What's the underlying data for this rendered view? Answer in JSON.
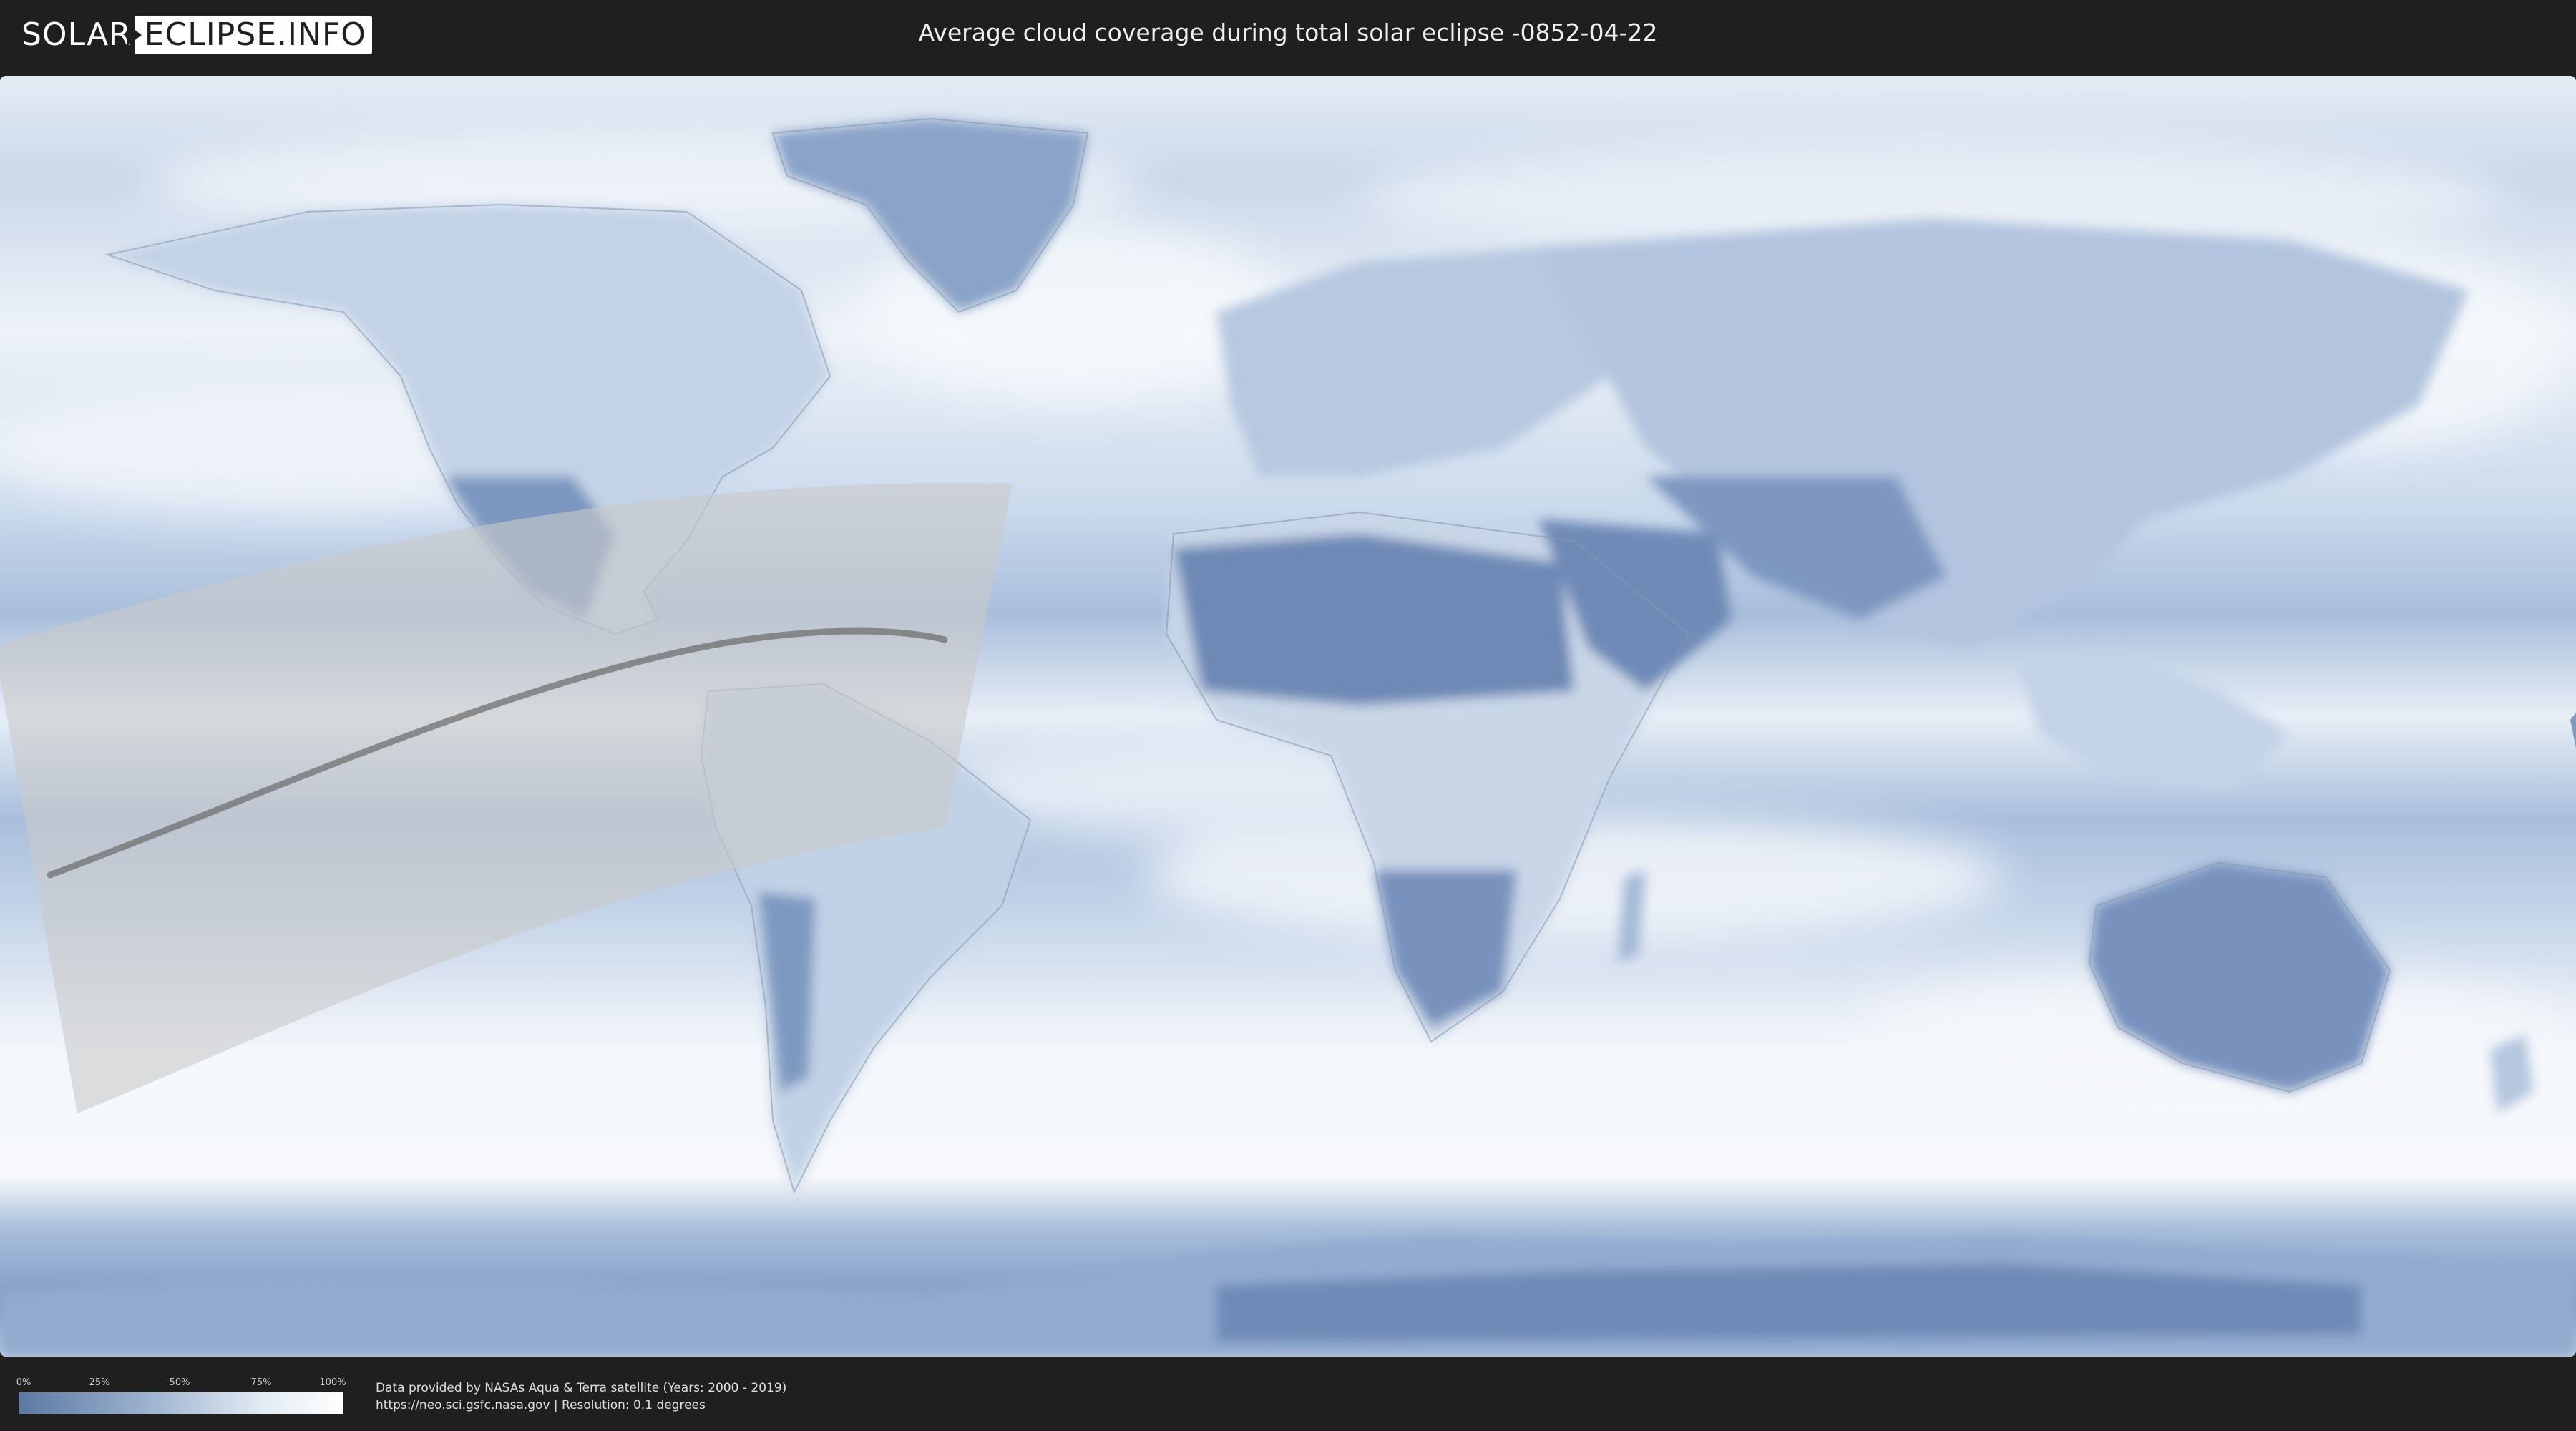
{
  "header": {
    "logo_left": "SOLAR",
    "logo_right": "ECLIPSE.INFO",
    "title": "Average cloud coverage during total solar eclipse -0852-04-22"
  },
  "map": {
    "colors": {
      "ocean_clear": "#7f9bc3",
      "cloud": "#f2f6fb",
      "land_clear": "#6b86b3",
      "eclipse_band": "#c9c9c9",
      "central_line": "#6a6a6a",
      "borders": "#8797ad"
    }
  },
  "legend": {
    "ticks": [
      "0%",
      "25%",
      "50%",
      "75%",
      "100%"
    ],
    "values": [
      0,
      0.25,
      0.5,
      0.75,
      1
    ]
  },
  "footer": {
    "credit_line1": "Data provided by NASAs Aqua & Terra satellite (Years: 2000 - 2019)",
    "credit_line2": "https://neo.sci.gsfc.nasa.gov | Resolution: 0.1 degrees"
  }
}
